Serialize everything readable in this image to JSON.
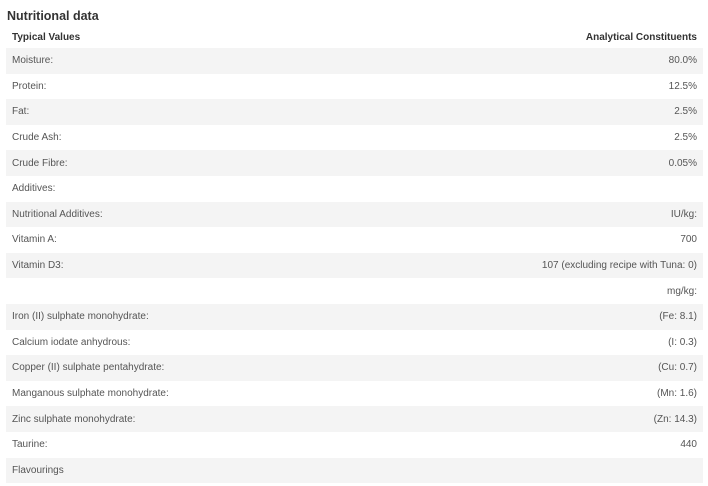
{
  "section_title": "Nutritional data",
  "table": {
    "headers": {
      "left": "Typical Values",
      "right": "Analytical Constituents"
    },
    "rows": [
      {
        "label": "Moisture:",
        "value": "80.0%"
      },
      {
        "label": "Protein:",
        "value": "12.5%"
      },
      {
        "label": "Fat:",
        "value": "2.5%"
      },
      {
        "label": "Crude Ash:",
        "value": "2.5%"
      },
      {
        "label": "Crude Fibre:",
        "value": "0.05%"
      },
      {
        "label": "Additives:",
        "value": ""
      },
      {
        "label": "Nutritional Additives:",
        "value": "IU/kg:"
      },
      {
        "label": "Vitamin A:",
        "value": "700"
      },
      {
        "label": "Vitamin D3:",
        "value": "107 (excluding recipe with Tuna: 0)"
      },
      {
        "label": "",
        "value": "mg/kg:"
      },
      {
        "label": "Iron (II) sulphate monohydrate:",
        "value": "(Fe: 8.1)"
      },
      {
        "label": "Calcium iodate anhydrous:",
        "value": "(I: 0.3)"
      },
      {
        "label": "Copper (II) sulphate pentahydrate:",
        "value": "(Cu: 0.7)"
      },
      {
        "label": "Manganous sulphate monohydrate:",
        "value": "(Mn: 1.6)"
      },
      {
        "label": "Zinc sulphate monohydrate:",
        "value": "(Zn: 14.3)"
      },
      {
        "label": "Taurine:",
        "value": "440"
      },
      {
        "label": "Flavourings",
        "value": ""
      }
    ]
  }
}
